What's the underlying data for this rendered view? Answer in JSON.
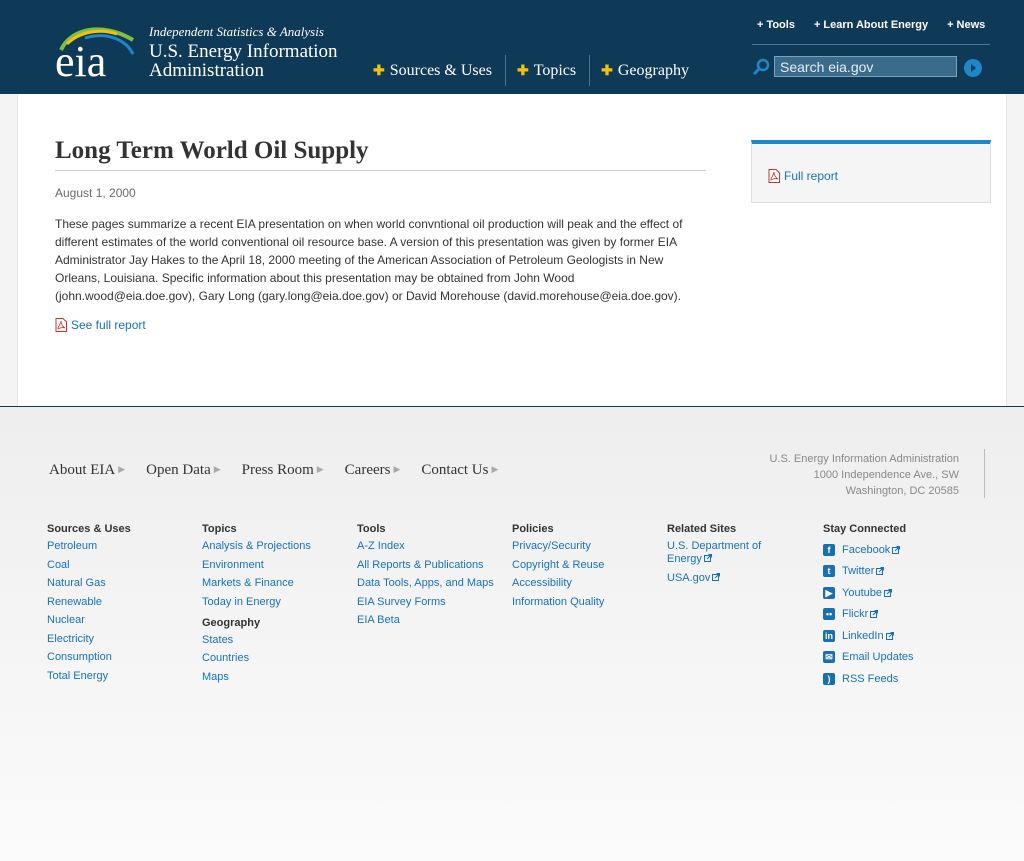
{
  "header": {
    "logo_text": "eia",
    "tagline": "Independent Statistics & Analysis",
    "org_name_line1": "U.S. Energy Information",
    "org_name_line2": "Administration",
    "main_nav": [
      "Sources & Uses",
      "Topics",
      "Geography"
    ],
    "util_nav": [
      "Tools",
      "Learn About Energy",
      "News"
    ],
    "search_placeholder": "Search eia.gov"
  },
  "article": {
    "title": "Long Term World Oil Supply",
    "date": "August 1, 2000",
    "summary": "These pages summarize a recent EIA presentation on when world convntional oil production will peak and the effect of different estimates of the world conventional oil resource base. A version of this presentation was given by former EIA Administrator Jay Hakes to the April 18, 2000 meeting of the American Association of Petroleum Geologists in New Orleans, Louisiana. Specific information about this presentation may be obtained from John Wood (john.wood@eia.doe.gov), Gary Long (gary.long@eia.doe.gov) or David Morehouse (david.morehouse@eia.doe.gov).",
    "see_full_report": "See full report",
    "sidebar_full_report": "Full report"
  },
  "footer": {
    "nav": [
      "About EIA",
      "Open Data",
      "Press Room",
      "Careers",
      "Contact Us"
    ],
    "address": [
      "U.S. Energy Information Administration",
      "1000 Independence Ave., SW",
      "Washington, DC 20585"
    ],
    "columns": {
      "sources": {
        "heading": "Sources & Uses",
        "links": [
          "Petroleum",
          "Coal",
          "Natural Gas",
          "Renewable",
          "Nuclear",
          "Electricity",
          "Consumption",
          "Total Energy"
        ]
      },
      "topics": {
        "heading": "Topics",
        "links": [
          "Analysis & Projections",
          "Environment",
          "Markets & Finance",
          "Today in Energy"
        ]
      },
      "geography": {
        "heading": "Geography",
        "links": [
          "States",
          "Countries",
          "Maps"
        ]
      },
      "tools": {
        "heading": "Tools",
        "links": [
          "A-Z Index",
          "All Reports & Publications",
          "Data Tools, Apps, and Maps",
          "EIA Survey Forms",
          "EIA Beta"
        ]
      },
      "policies": {
        "heading": "Policies",
        "links": [
          "Privacy/Security",
          "Copyright & Reuse",
          "Accessibility",
          "Information Quality"
        ]
      },
      "related": {
        "heading": "Related Sites",
        "links": [
          "U.S. Department of Energy",
          "USA.gov"
        ]
      },
      "connected": {
        "heading": "Stay Connected",
        "links": [
          "Facebook",
          "Twitter",
          "Youtube",
          "Flickr",
          "LinkedIn",
          "Email Updates",
          "RSS Feeds"
        ]
      }
    }
  },
  "colors": {
    "header_bg": "#0f3a57",
    "link_blue": "#1871b8",
    "accent_yellow": "#f4c10f",
    "accent_blue": "#1e87c7"
  },
  "icons": [
    "eia-logo",
    "plus-icon",
    "search-icon",
    "search-go-icon",
    "pdf-icon",
    "arrow-icon",
    "external-link-icon",
    "facebook-icon",
    "twitter-icon",
    "youtube-icon",
    "flickr-icon",
    "linkedin-icon",
    "email-icon",
    "rss-icon"
  ]
}
